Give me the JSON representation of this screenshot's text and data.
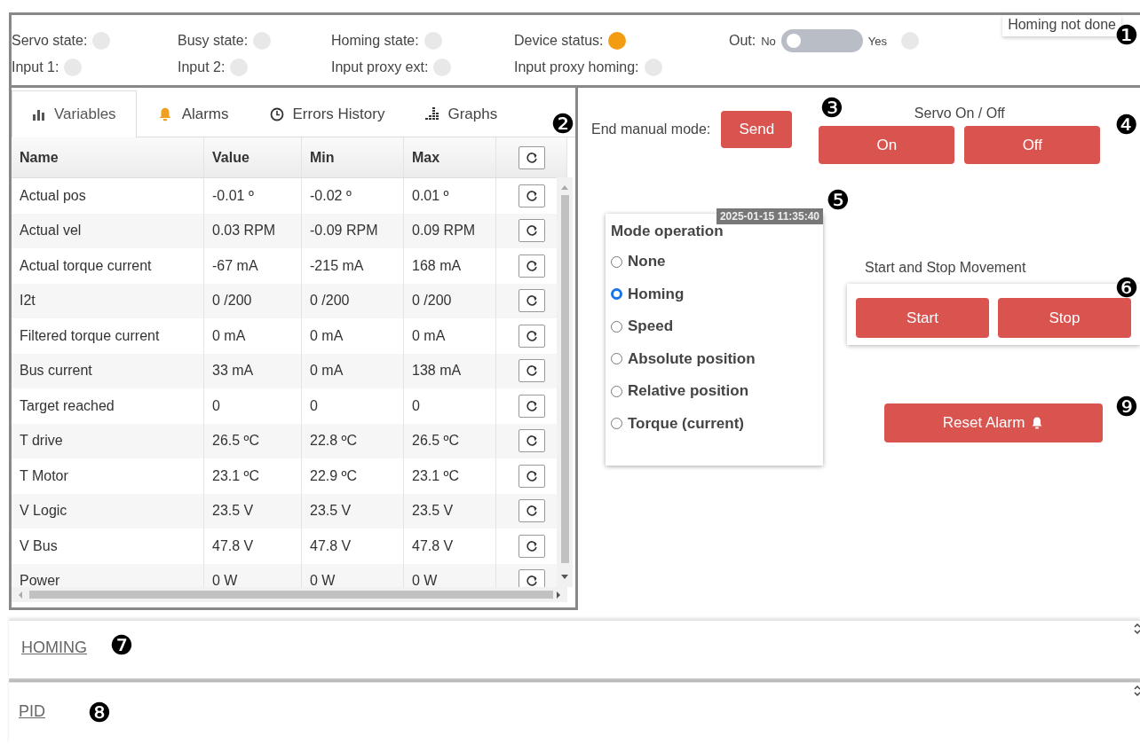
{
  "status": {
    "indicators": [
      {
        "label": "Servo state:",
        "color": "#e8e8e8"
      },
      {
        "label": "Busy state:",
        "color": "#e8e8e8"
      },
      {
        "label": "Homing state:",
        "color": "#e8e8e8"
      },
      {
        "label": "Device status:",
        "color": "#f39c12"
      },
      {
        "label": "Input 1:",
        "color": "#e8e8e8"
      },
      {
        "label": "Input 2:",
        "color": "#e8e8e8"
      },
      {
        "label": "Input proxy ext:",
        "color": "#e8e8e8"
      },
      {
        "label": "Input proxy homing:",
        "color": "#e8e8e8"
      }
    ],
    "output": {
      "label": "Out:",
      "off_label": "No",
      "on_label": "Yes",
      "on": false,
      "color": "#e8e8e8"
    },
    "tooltip": "Homing not done"
  },
  "tabs": [
    {
      "label": "Variables",
      "selected": true
    },
    {
      "label": "Alarms",
      "selected": false
    },
    {
      "label": "Errors History",
      "selected": false
    },
    {
      "label": "Graphs",
      "selected": false
    }
  ],
  "table": {
    "columns": [
      "Name",
      "Value",
      "Min",
      "Max"
    ],
    "rows": [
      [
        "Actual pos",
        "-0.01 º",
        "-0.02 º",
        "0.01 º"
      ],
      [
        "Actual vel",
        "0.03 RPM",
        "-0.09 RPM",
        "0.09 RPM"
      ],
      [
        "Actual torque current",
        "-67 mA",
        "-215 mA",
        "168 mA"
      ],
      [
        "I2t",
        "0 /200",
        "0 /200",
        "0 /200"
      ],
      [
        "Filtered torque current",
        "0 mA",
        "0 mA",
        "0 mA"
      ],
      [
        "Bus current",
        "33 mA",
        "0 mA",
        "138 mA"
      ],
      [
        "Target reached",
        "0",
        "0",
        "0"
      ],
      [
        "T drive",
        "26.5 ºC",
        "22.8 ºC",
        "26.5 ºC"
      ],
      [
        "T Motor",
        "23.1 ºC",
        "22.9 ºC",
        "23.1 ºC"
      ],
      [
        "V Logic",
        "23.5 V",
        "23.5 V",
        "23.5 V"
      ],
      [
        "V Bus",
        "47.8 V",
        "47.8 V",
        "47.8 V"
      ],
      [
        "Power",
        "0 W",
        "0 W",
        "0 W"
      ]
    ]
  },
  "manual": {
    "label": "End manual mode:",
    "button": "Send"
  },
  "servo": {
    "title": "Servo On / Off",
    "buttons": [
      "On",
      "Off"
    ]
  },
  "mode": {
    "timestamp": "2025-01-15 11:35:40",
    "title": "Mode operation",
    "options": [
      {
        "label": "None",
        "selected": false
      },
      {
        "label": "Homing",
        "selected": true
      },
      {
        "label": "Speed",
        "selected": false
      },
      {
        "label": "Absolute position",
        "selected": false
      },
      {
        "label": "Relative position",
        "selected": false
      },
      {
        "label": "Torque (current)",
        "selected": false
      }
    ]
  },
  "movement": {
    "title": "Start and Stop Movement",
    "buttons": [
      "Start",
      "Stop"
    ]
  },
  "reset_button": "Reset Alarm",
  "sections": [
    {
      "title": "HOMING"
    },
    {
      "title": "PID"
    }
  ],
  "callouts": [
    "❶",
    "❷",
    "❸",
    "❹",
    "❺",
    "❻",
    "❼",
    "❽",
    "❾"
  ]
}
